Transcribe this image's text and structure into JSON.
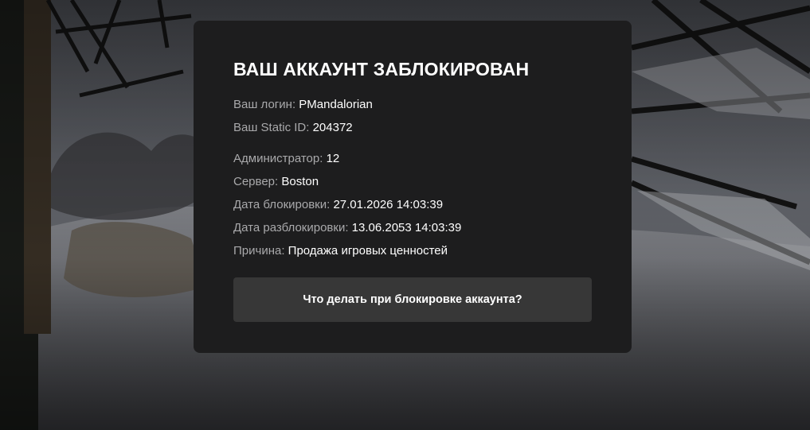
{
  "dialog": {
    "title": "ВАШ АККАУНТ ЗАБЛОКИРОВАН",
    "account": [
      {
        "key": "Ваш логин:",
        "value": "PMandalorian"
      },
      {
        "key": "Ваш Static ID:",
        "value": "204372"
      }
    ],
    "details": [
      {
        "key": "Администратор:",
        "value": "12"
      },
      {
        "key": "Сервер:",
        "value": "Boston"
      },
      {
        "key": "Дата блокировки:",
        "value": "27.01.2026 14:03:39"
      },
      {
        "key": "Дата разблокировки:",
        "value": "13.06.2053 14:03:39"
      },
      {
        "key": "Причина:",
        "value": "Продажа игровых ценностей"
      }
    ],
    "help_button_label": "Что делать при блокировке аккаунта?"
  },
  "colors": {
    "panel": "#1d1d1e",
    "button": "#373737",
    "label": "#a9a9ab",
    "value": "#ffffff"
  }
}
